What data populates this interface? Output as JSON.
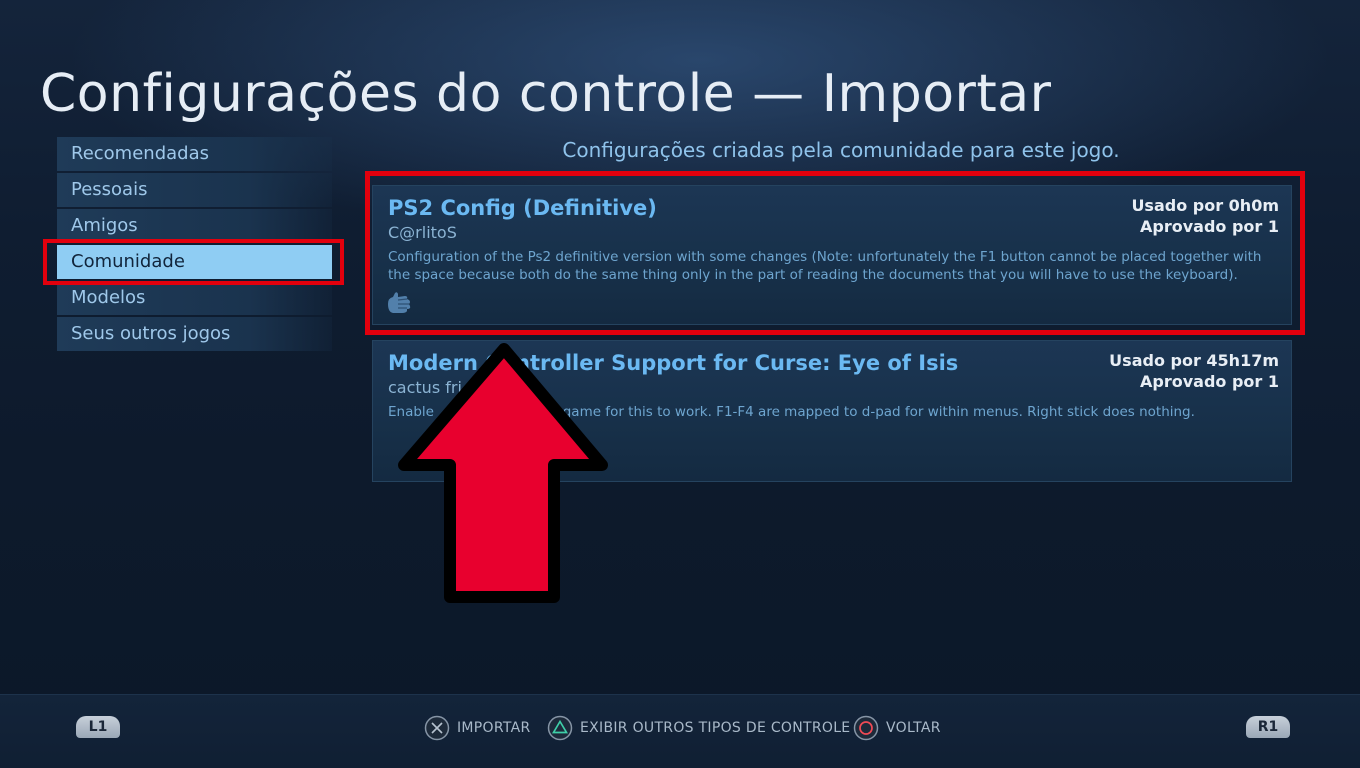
{
  "page": {
    "title": "Configurações do controle — Importar",
    "subtitle": "Configurações criadas pela comunidade para este jogo."
  },
  "sidebar": {
    "items": [
      {
        "label": "Recomendadas",
        "active": false
      },
      {
        "label": "Pessoais",
        "active": false
      },
      {
        "label": "Amigos",
        "active": false
      },
      {
        "label": "Comunidade",
        "active": true
      },
      {
        "label": "Modelos",
        "active": false
      },
      {
        "label": "Seus outros jogos",
        "active": false
      }
    ]
  },
  "configs": [
    {
      "title": "PS2 Config (Definitive)",
      "author": "C@rlitoS",
      "description": "Configuration of the Ps2 definitive version with some changes (Note: unfortunately the F1 button cannot be placed together with the space because both do the same thing only in the part of reading the documents that you will have to use the keyboard).",
      "used": "Usado por 0h0m",
      "approved": "Aprovado por 1",
      "icon": "hand-icon"
    },
    {
      "title": "Modern Controller Support for Curse: Eye of Isis",
      "author": "cactus fri",
      "description": "Enable                              game for this to work. F1-F4 are mapped to d-pad for within menus. Right stick does nothing.",
      "used": "Usado por 45h17m",
      "approved": "Aprovado por 1"
    }
  ],
  "footer": {
    "l1": "L1",
    "r1": "R1",
    "import_label": "IMPORTAR",
    "other_types_label": "EXIBIR OUTROS TIPOS DE CONTROLE",
    "back_label": "VOLTAR",
    "icons": {
      "import": "cross-button-icon",
      "other_types": "triangle-button-icon",
      "back": "circle-button-icon"
    }
  },
  "colors": {
    "highlight": "#e2000d",
    "accent": "#6bb9f2",
    "active_tab": "#8fcdf3",
    "arrow_fill": "#e8002e"
  }
}
